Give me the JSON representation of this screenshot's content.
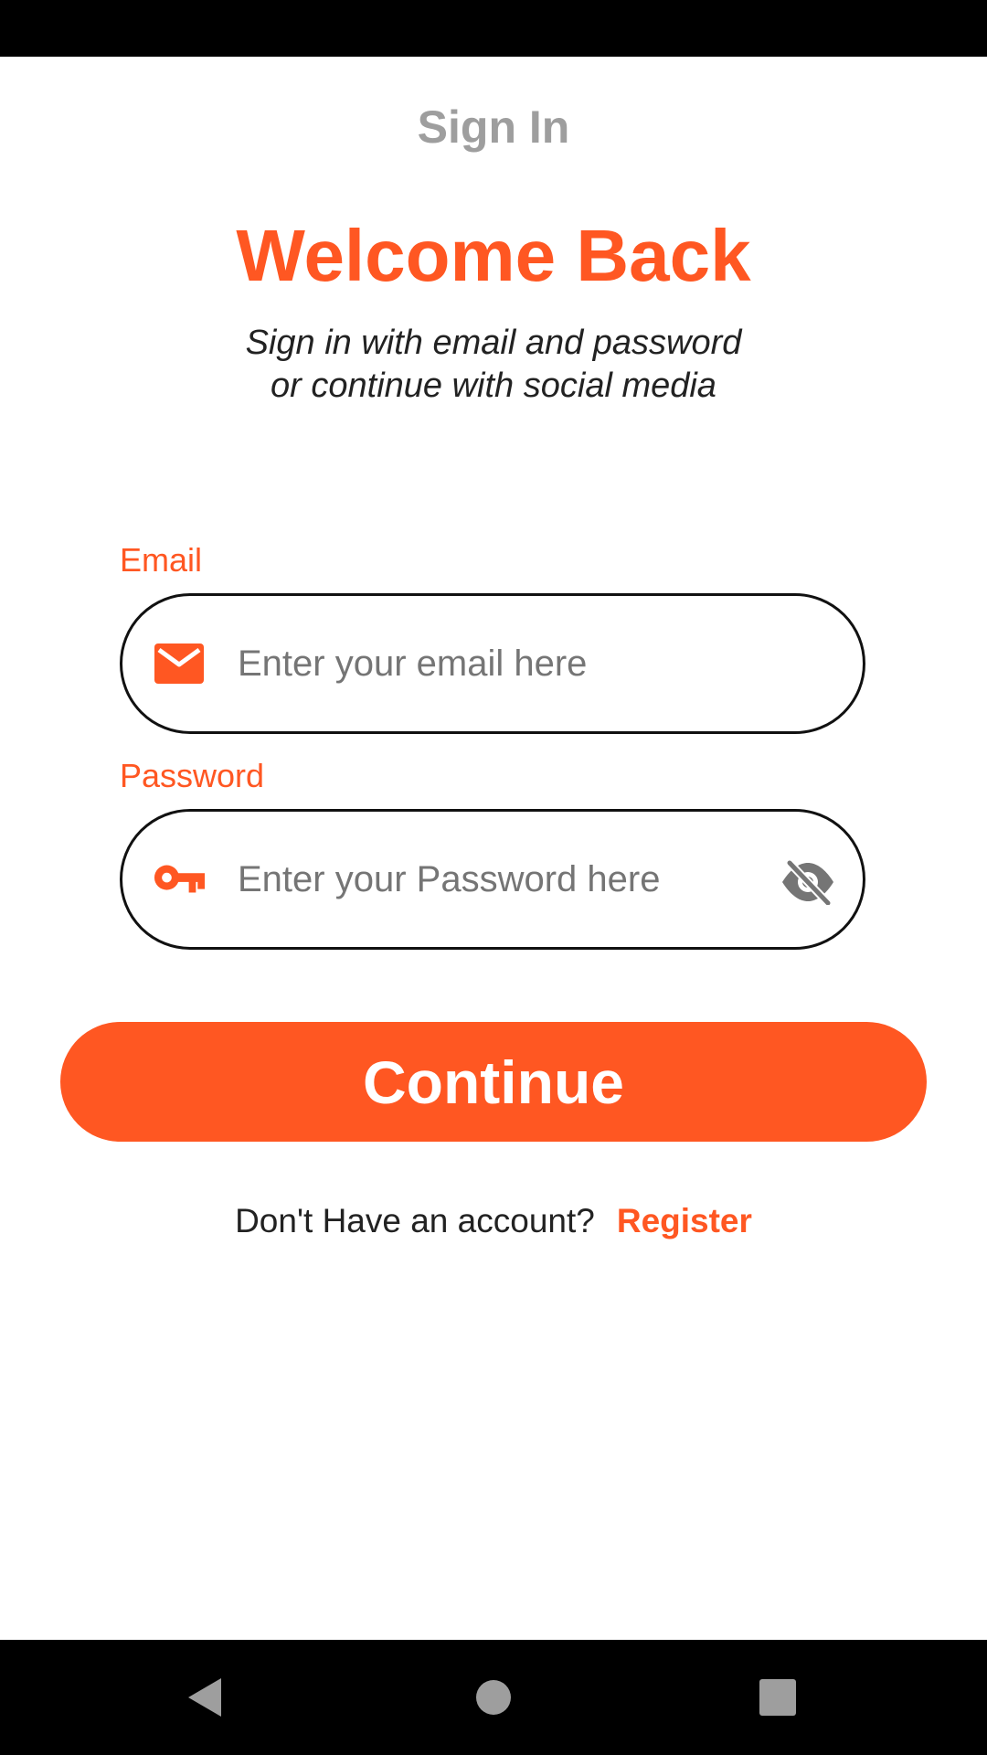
{
  "colors": {
    "accent": "#FF5722",
    "appbar_title": "#9E9E9E",
    "field_border": "#111111",
    "icon_grey": "#757575",
    "system_bars": "#000000"
  },
  "appbar": {
    "title": "Sign In"
  },
  "header": {
    "welcome": "Welcome Back",
    "subtitle_line1": "Sign in with email and password",
    "subtitle_line2": "or continue with social media"
  },
  "form": {
    "email": {
      "label": "Email",
      "placeholder": "Enter your email here",
      "value": "",
      "icon": "mail-icon"
    },
    "password": {
      "label": "Password",
      "placeholder": "Enter your Password here",
      "value": "",
      "icon": "key-icon",
      "toggle_icon": "visibility-off-icon"
    },
    "continue_label": "Continue"
  },
  "footer": {
    "prompt": "Don't Have an account?",
    "register_label": "Register"
  },
  "navbar": {
    "buttons": [
      "back-icon",
      "home-icon",
      "recents-icon"
    ]
  }
}
